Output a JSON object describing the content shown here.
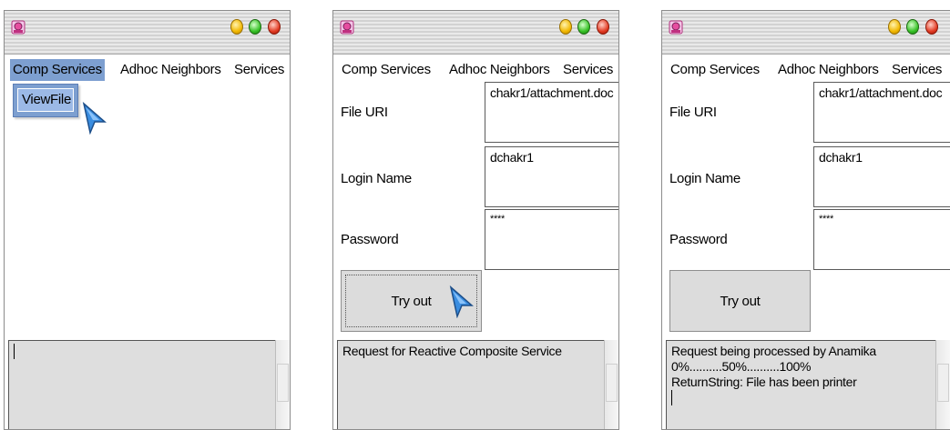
{
  "menu": {
    "comp_services": "Comp Services",
    "adhoc_neighbors": "Adhoc Neighbors",
    "services": "Services"
  },
  "window1": {
    "dropdown_item": "ViewFile",
    "status_text": ""
  },
  "window2": {
    "file_uri_label": "File URI",
    "file_uri_value": "chakr1/attachment.doc",
    "login_label": "Login Name",
    "login_value": "dchakr1",
    "password_label": "Password",
    "password_value": "****",
    "try_button": "Try out",
    "status_line1": "Request for Reactive Composite Service"
  },
  "window3": {
    "file_uri_label": "File URI",
    "file_uri_value": "chakr1/attachment.doc",
    "login_label": "Login Name",
    "login_value": "dchakr1",
    "password_label": "Password",
    "password_value": "****",
    "try_button": "Try out",
    "status_line1": "Request being processed by Anamika",
    "status_line2": "0%..........50%..........100%",
    "status_line3": "ReturnString: File has been printer"
  },
  "colors": {
    "menu_highlight": "#7d9fd0",
    "cursor_blue": "#3a8de0"
  },
  "icons": [
    "app-icon",
    "minimize-light",
    "zoom-light",
    "close-light",
    "pointer-cursor"
  ]
}
